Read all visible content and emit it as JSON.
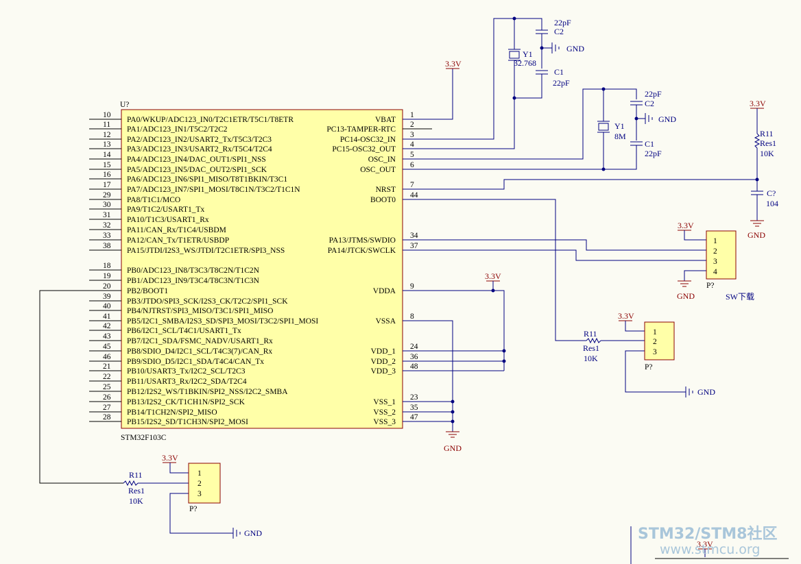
{
  "mcu": {
    "designator": "U?",
    "part": "STM32F103C",
    "left_pins": [
      {
        "num": "10",
        "name": "PA0/WKUP/ADC123_IN0/T2C1ETR/T5C1/T8ETR"
      },
      {
        "num": "11",
        "name": "PA1/ADC123_IN1/T5C2/T2C2"
      },
      {
        "num": "12",
        "name": "PA2/ADC123_IN2/USART2_Tx/T5C3/T2C3"
      },
      {
        "num": "13",
        "name": "PA3/ADC123_IN3/USART2_Rx/T5C4/T2C4"
      },
      {
        "num": "14",
        "name": "PA4/ADC123_IN4/DAC_OUT1/SPI1_NSS"
      },
      {
        "num": "15",
        "name": "PA5/ADC123_IN5/DAC_OUT2/SPI1_SCK"
      },
      {
        "num": "16",
        "name": "PA6/ADC123_IN6/SPI1_MISO/T8T1BKIN/T3C1"
      },
      {
        "num": "17",
        "name": "PA7/ADC123_IN7/SPI1_MOSI/T8C1N/T3C2/T1C1N"
      },
      {
        "num": "29",
        "name": "PA8/T1C1/MCO"
      },
      {
        "num": "30",
        "name": "PA9/T1C2/USART1_Tx"
      },
      {
        "num": "31",
        "name": "PA10/T1C3/USART1_Rx"
      },
      {
        "num": "32",
        "name": "PA11/CAN_Rx/T1C4/USBDM"
      },
      {
        "num": "33",
        "name": "PA12/CAN_Tx/T1ETR/USBDP"
      },
      {
        "num": "38",
        "name": "PA15/JTDI/I2S3_WS/JTDI/T2C1ETR/SPI3_NSS"
      },
      {
        "num": "18",
        "name": "PB0/ADC123_IN8/T3C3/T8C2N/T1C2N"
      },
      {
        "num": "19",
        "name": "PB1/ADC123_IN9/T3C4/T8C3N/T1C3N"
      },
      {
        "num": "20",
        "name": "PB2/BOOT1"
      },
      {
        "num": "39",
        "name": "PB3/JTDO/SPI3_SCK/I2S3_CK/T2C2/SPI1_SCK"
      },
      {
        "num": "40",
        "name": "PB4/NJTRST/SPI3_MISO/T3C1/SPI1_MISO"
      },
      {
        "num": "41",
        "name": "PB5/I2C1_SMBA/I2S3_SD/SPI3_MOSI/T3C2/SPI1_MOSI"
      },
      {
        "num": "42",
        "name": "PB6/I2C1_SCL/T4C1/USART1_Tx"
      },
      {
        "num": "43",
        "name": "PB7/I2C1_SDA/FSMC_NADV/USART1_Rx"
      },
      {
        "num": "45",
        "name": "PB8/SDIO_D4/I2C1_SCL/T4C3(7)/CAN_Rx"
      },
      {
        "num": "46",
        "name": "PB9/SDIO_D5/I2C1_SDA/T4C4/CAN_Tx"
      },
      {
        "num": "21",
        "name": "PB10/USART3_Tx/I2C2_SCL/T2C3"
      },
      {
        "num": "22",
        "name": "PB11/USART3_Rx/I2C2_SDA/T2C4"
      },
      {
        "num": "25",
        "name": "PB12/I2S2_WS/T1BKIN/SPI2_NSS/I2C2_SMBA"
      },
      {
        "num": "26",
        "name": "PB13/I2S2_CK/T1CH1N/SPI2_SCK"
      },
      {
        "num": "27",
        "name": "PB14/T1CH2N/SPI2_MISO"
      },
      {
        "num": "28",
        "name": "PB15/I2S2_SD/T1CH3N/SPI2_MOSI"
      }
    ],
    "right_pins": [
      {
        "num": "1",
        "name": "VBAT"
      },
      {
        "num": "2",
        "name": "PC13-TAMPER-RTC"
      },
      {
        "num": "3",
        "name": "PC14-OSC32_IN"
      },
      {
        "num": "4",
        "name": "PC15-OSC32_OUT"
      },
      {
        "num": "5",
        "name": "OSC_IN"
      },
      {
        "num": "6",
        "name": "OSC_OUT"
      },
      {
        "num": "7",
        "name": "NRST"
      },
      {
        "num": "44",
        "name": "BOOT0"
      },
      {
        "num": "34",
        "name": "PA13/JTMS/SWDIO"
      },
      {
        "num": "37",
        "name": "PA14/JTCK/SWCLK"
      },
      {
        "num": "9",
        "name": "VDDA"
      },
      {
        "num": "8",
        "name": "VSSA"
      },
      {
        "num": "24",
        "name": "VDD_1"
      },
      {
        "num": "36",
        "name": "VDD_2"
      },
      {
        "num": "48",
        "name": "VDD_3"
      },
      {
        "num": "23",
        "name": "VSS_1"
      },
      {
        "num": "35",
        "name": "VSS_2"
      },
      {
        "num": "47",
        "name": "VSS_3"
      }
    ]
  },
  "labels": {
    "v33": "3.3V",
    "gnd": "GND",
    "cap22": "22pF",
    "c1": "C1",
    "c2": "C2",
    "cq": "C?",
    "c104": "104",
    "y1": "Y1",
    "f32": "32.768",
    "f8": "8M",
    "r11": "R11",
    "res1": "Res1",
    "r10k": "10K",
    "p": "P?",
    "n1": "1",
    "n2": "2",
    "n3": "3",
    "n4": "4",
    "sw": "SW下载"
  },
  "watermark": {
    "title_a": "STM32",
    "title_sep": "/",
    "title_b": "STM8社区",
    "url": "www.stmcu.org"
  }
}
